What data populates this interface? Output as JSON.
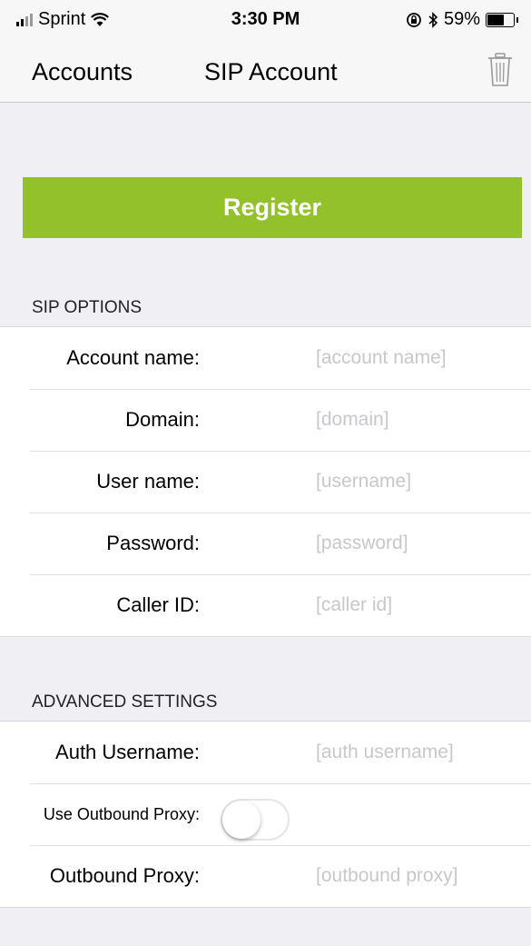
{
  "status_bar": {
    "carrier": "Sprint",
    "time": "3:30 PM",
    "battery_text": "59%",
    "battery_level": 0.59,
    "icons": [
      "signal-icon",
      "wifi-icon",
      "rotation-lock-icon",
      "bluetooth-icon",
      "battery-icon"
    ]
  },
  "nav": {
    "back_label": "Accounts",
    "title": "SIP Account",
    "trash_icon": "trash-icon"
  },
  "register": {
    "label": "Register",
    "color": "#92c12c"
  },
  "sip_options": {
    "header": "SIP OPTIONS",
    "fields": [
      {
        "label": "Account name:",
        "placeholder": "[account name]",
        "value": ""
      },
      {
        "label": "Domain:",
        "placeholder": "[domain]",
        "value": ""
      },
      {
        "label": "User name:",
        "placeholder": "[username]",
        "value": ""
      },
      {
        "label": "Password:",
        "placeholder": "[password]",
        "value": ""
      },
      {
        "label": "Caller ID:",
        "placeholder": "[caller id]",
        "value": ""
      }
    ]
  },
  "advanced": {
    "header": "ADVANCED SETTINGS",
    "auth_username": {
      "label": "Auth Username:",
      "placeholder": "[auth username]",
      "value": ""
    },
    "use_outbound_proxy": {
      "label": "Use Outbound Proxy:",
      "on": false
    },
    "outbound_proxy": {
      "label": "Outbound Proxy:",
      "placeholder": "[outbound proxy]",
      "value": ""
    }
  }
}
